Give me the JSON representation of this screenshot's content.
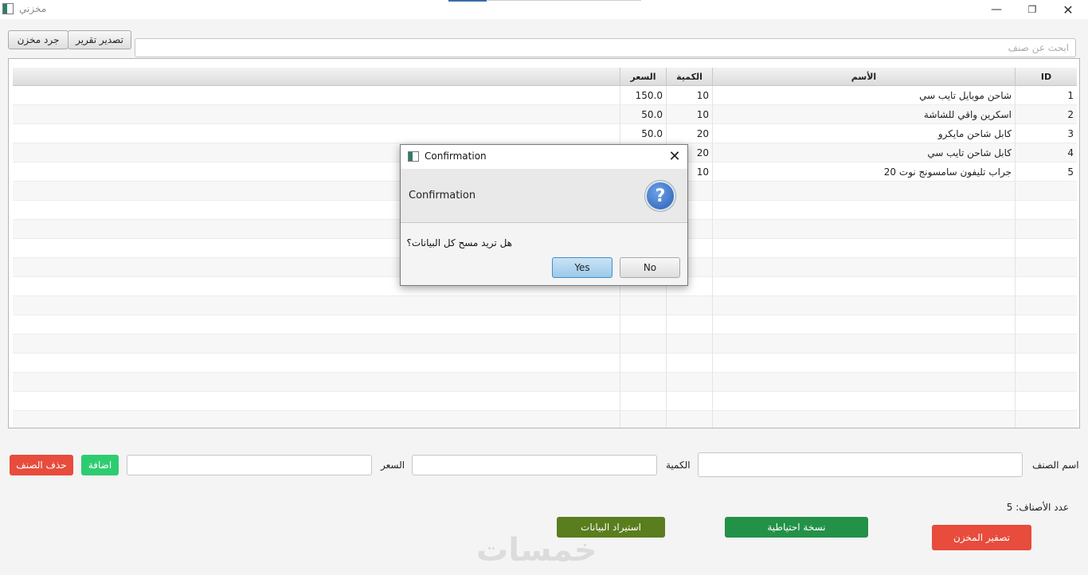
{
  "window": {
    "title": "مخزني"
  },
  "toolbar": {
    "inventory_label": "جرد مخزن",
    "export_label": "تصدير تقرير"
  },
  "search": {
    "placeholder": "ابحث عن صنف"
  },
  "table": {
    "headers": {
      "id": "ID",
      "name": "الأسم",
      "quantity": "الكمية",
      "price": "السعر"
    },
    "rows": [
      {
        "id": "1",
        "name": "شاحن موبايل تايب سي",
        "quantity": "10",
        "price": "150.0"
      },
      {
        "id": "2",
        "name": "اسكرين واقي للشاشة",
        "quantity": "10",
        "price": "50.0"
      },
      {
        "id": "3",
        "name": "كابل شاحن مايكرو",
        "quantity": "20",
        "price": "50.0"
      },
      {
        "id": "4",
        "name": "كابل شاحن تايب سي",
        "quantity": "20",
        "price": ""
      },
      {
        "id": "5",
        "name": "جراب تليفون سامسونج نوت 20",
        "quantity": "10",
        "price": ""
      }
    ]
  },
  "form": {
    "name_label": "اسم الصنف",
    "quantity_label": "الكمية",
    "price_label": "السعر",
    "add_label": "اضافة",
    "delete_label": "حذف الصنف"
  },
  "footer": {
    "count_text": "عدد الأصناف: 5",
    "reset_label": "تصفير المخزن",
    "backup_label": "نسخة احتياطية",
    "restore_label": "استيراد البيانات",
    "watermark": "خمسات"
  },
  "dialog": {
    "title": "Confirmation",
    "header": "Confirmation",
    "message": "هل تريد مسح كل البيانات؟",
    "yes_label": "Yes",
    "no_label": "No"
  },
  "colors": {
    "danger": "#e74c3c",
    "add": "#2ecc71",
    "backup": "#239148",
    "restore": "#5a7d1e",
    "default_button": "#3f8fcf"
  },
  "icons": {
    "app": "app-icon",
    "minimize": "minimize-icon",
    "maximize": "restore-icon",
    "close": "close-icon",
    "question": "question-icon"
  }
}
